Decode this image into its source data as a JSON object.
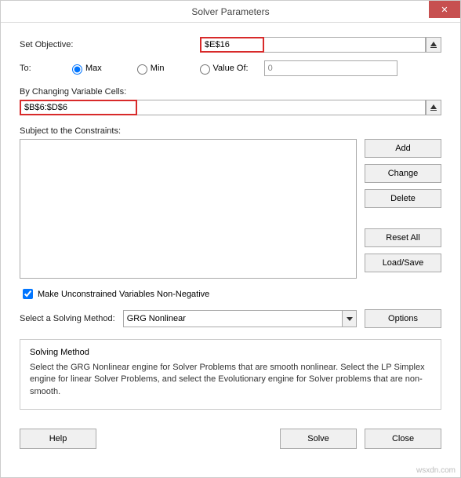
{
  "title": "Solver Parameters",
  "labels": {
    "set_objective": "Set Objective:",
    "to": "To:",
    "max": "Max",
    "min": "Min",
    "value_of": "Value Of:",
    "changing_cells": "By Changing Variable Cells:",
    "subject": "Subject to the Constraints:",
    "nonneg": "Make Unconstrained Variables Non-Negative",
    "select_method": "Select a Solving Method:"
  },
  "values": {
    "objective": "$E$16",
    "value_of": "0",
    "changing_cells": "$B$6:$D$6",
    "method": "GRG Nonlinear",
    "nonneg_checked": true,
    "to_option": "max"
  },
  "buttons": {
    "add": "Add",
    "change": "Change",
    "delete": "Delete",
    "reset": "Reset All",
    "loadsave": "Load/Save",
    "options": "Options",
    "help": "Help",
    "solve": "Solve",
    "close": "Close"
  },
  "info": {
    "title": "Solving Method",
    "text": "Select the GRG Nonlinear engine for Solver Problems that are smooth nonlinear. Select the LP Simplex engine for linear Solver Problems, and select the Evolutionary engine for Solver problems that are non-smooth."
  },
  "watermark": "wsxdn.com"
}
